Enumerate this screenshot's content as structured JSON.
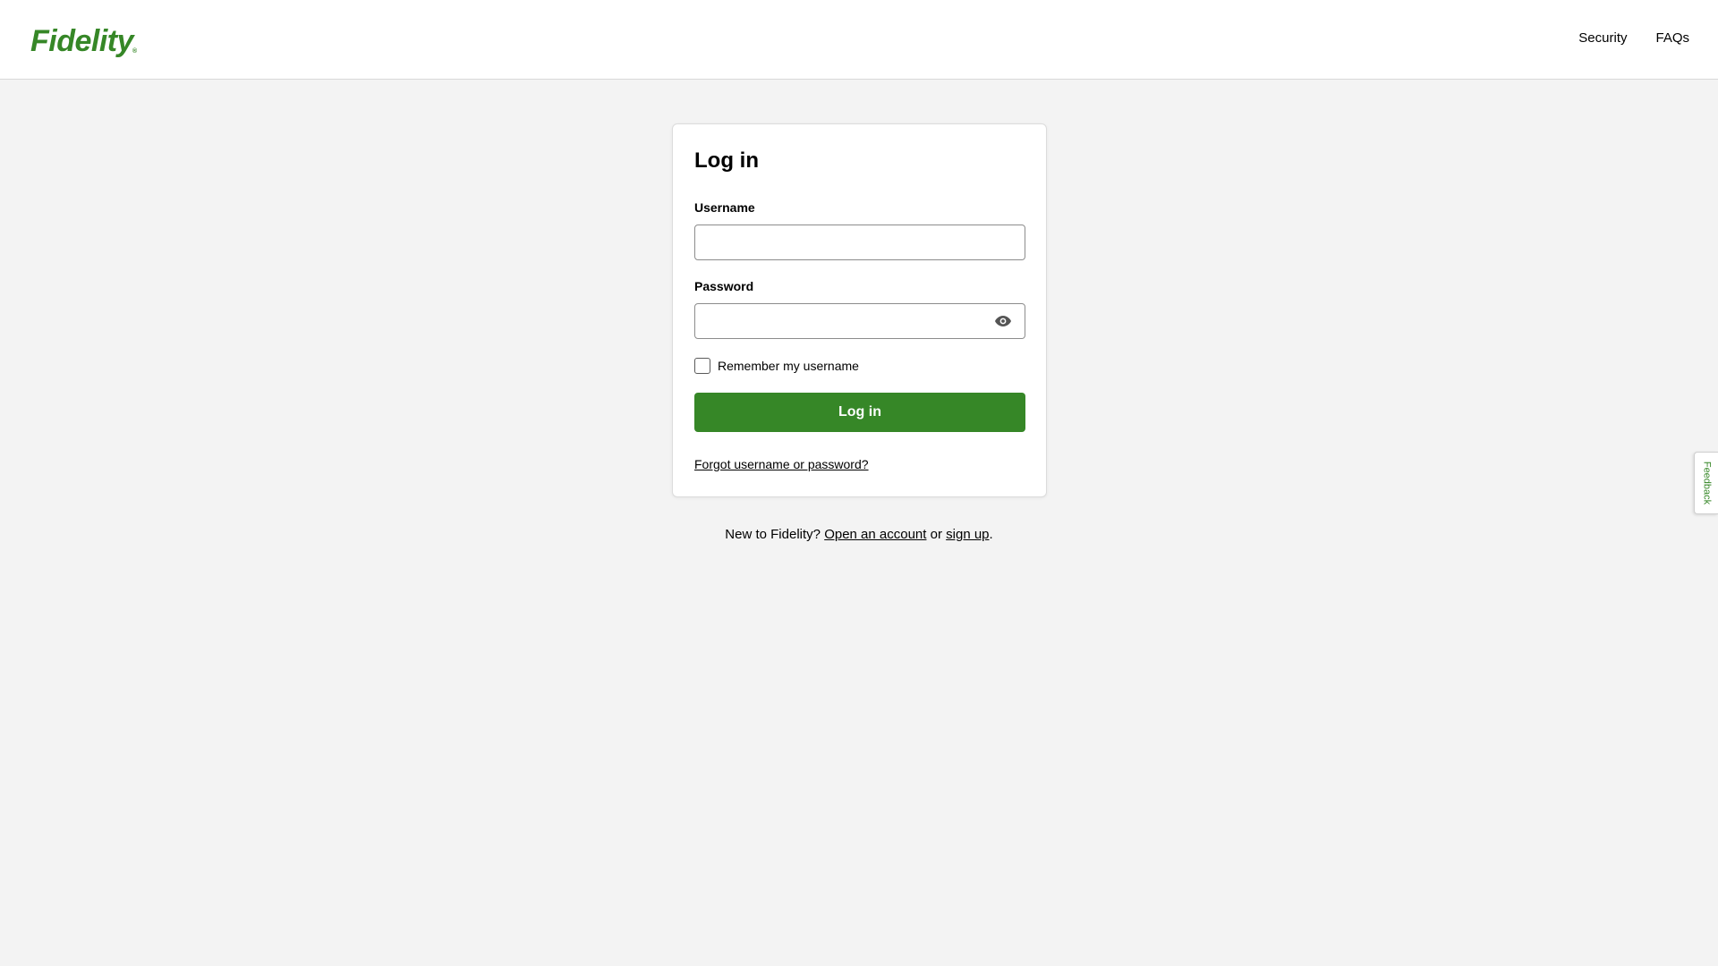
{
  "header": {
    "logo_text": "Fidelity",
    "logo_reg": "®",
    "nav": [
      {
        "label": "Security"
      },
      {
        "label": "FAQs"
      }
    ]
  },
  "login_card": {
    "title": "Log in",
    "username_label": "Username",
    "username_value": "",
    "password_label": "Password",
    "password_value": "",
    "show_password_icon": "eye-icon",
    "remember_label": "Remember my username",
    "remember_checked": false,
    "submit_label": "Log in",
    "forgot_link": "Forgot username or password?"
  },
  "signup": {
    "prefix": "New to Fidelity?",
    "open_account_link": "Open an account",
    "middle": "or",
    "sign_up_link": "sign up",
    "suffix": "."
  },
  "feedback_tab": {
    "label": "Feedback"
  },
  "colors": {
    "brand_green": "#368727",
    "page_background": "#f3f3f3",
    "card_background": "#ffffff"
  }
}
